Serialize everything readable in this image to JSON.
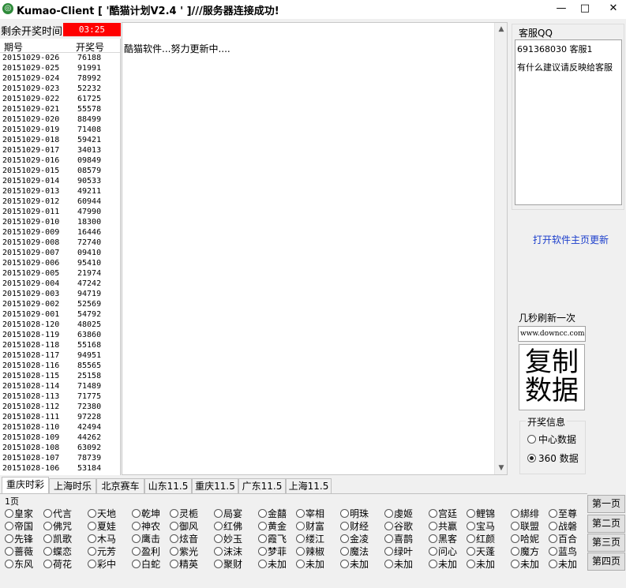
{
  "window": {
    "title": "Kumao-Client [ '酷猫计划V2.4 ' ]///服务器连接成功!",
    "min": "—",
    "max": "□",
    "close": "✕"
  },
  "countdown": {
    "label": "剩余开奖时间:",
    "value": "03:25"
  },
  "history": {
    "headers": [
      "期号",
      "开奖号"
    ],
    "rows": [
      [
        "20151029-026",
        "76188"
      ],
      [
        "20151029-025",
        "91991"
      ],
      [
        "20151029-024",
        "78992"
      ],
      [
        "20151029-023",
        "52232"
      ],
      [
        "20151029-022",
        "61725"
      ],
      [
        "20151029-021",
        "55578"
      ],
      [
        "20151029-020",
        "88499"
      ],
      [
        "20151029-019",
        "71408"
      ],
      [
        "20151029-018",
        "59421"
      ],
      [
        "20151029-017",
        "34013"
      ],
      [
        "20151029-016",
        "09849"
      ],
      [
        "20151029-015",
        "08579"
      ],
      [
        "20151029-014",
        "90533"
      ],
      [
        "20151029-013",
        "49211"
      ],
      [
        "20151029-012",
        "60944"
      ],
      [
        "20151029-011",
        "47990"
      ],
      [
        "20151029-010",
        "18300"
      ],
      [
        "20151029-009",
        "16446"
      ],
      [
        "20151029-008",
        "72740"
      ],
      [
        "20151029-007",
        "09410"
      ],
      [
        "20151029-006",
        "95410"
      ],
      [
        "20151029-005",
        "21974"
      ],
      [
        "20151029-004",
        "47242"
      ],
      [
        "20151029-003",
        "94719"
      ],
      [
        "20151029-002",
        "52569"
      ],
      [
        "20151029-001",
        "54792"
      ],
      [
        "20151028-120",
        "48025"
      ],
      [
        "20151028-119",
        "63860"
      ],
      [
        "20151028-118",
        "55168"
      ],
      [
        "20151028-117",
        "94951"
      ],
      [
        "20151028-116",
        "85565"
      ],
      [
        "20151028-115",
        "25158"
      ],
      [
        "20151028-114",
        "71489"
      ],
      [
        "20151028-113",
        "71775"
      ],
      [
        "20151028-112",
        "72380"
      ],
      [
        "20151028-111",
        "97228"
      ],
      [
        "20151028-110",
        "42494"
      ],
      [
        "20151028-109",
        "44262"
      ],
      [
        "20151028-108",
        "63092"
      ],
      [
        "20151028-107",
        "78739"
      ],
      [
        "20151028-106",
        "53184"
      ]
    ]
  },
  "center": {
    "message": "酷猫软件...努力更新中...."
  },
  "support": {
    "label": "客服QQ",
    "line1": "691368030   客服1",
    "line2": "有什么建议请反映给客服"
  },
  "links": {
    "open_home": "打开软件主页更新"
  },
  "refresh": {
    "label": "几秒刷新一次",
    "site": "www.downcc.com"
  },
  "copy_button": {
    "line1": "复制",
    "line2": "数据"
  },
  "prize_info": {
    "title": "开奖信息",
    "options": [
      "中心数据",
      "360 数据"
    ],
    "selected": "360 数据"
  },
  "tabs": [
    "重庆时彩",
    "上海时乐",
    "北京赛车",
    "山东11.5",
    "重庆11.5",
    "广东11.5",
    "上海11.5"
  ],
  "active_tab": "重庆时彩",
  "page_label": "1页",
  "plan_options": [
    [
      "皇家",
      "代言",
      "天地",
      "乾坤",
      "灵栀",
      "局宴",
      "金囍",
      "宰相",
      "明珠",
      "虔姬",
      "宫廷",
      "鲤锦",
      "綁绯",
      "至尊"
    ],
    [
      "帝国",
      "佛咒",
      "夏娃",
      "神农",
      "御风",
      "红佛",
      "黄金",
      "财富",
      "财经",
      "谷歌",
      "共赢",
      "宝马",
      "联盟",
      "战磐"
    ],
    [
      "先锋",
      "凯歌",
      "木马",
      "鹰击",
      "炫音",
      "妙玉",
      "霞飞",
      "缕江",
      "金凌",
      "喜鹊",
      "黑客",
      "红颜",
      "哈妮",
      "百合"
    ],
    [
      "蔷薇",
      "蝶恋",
      "元芳",
      "盈利",
      "紫光",
      "沫沫",
      "梦菲",
      "辣椒",
      "魔法",
      "绿叶",
      "问心",
      "天蓬",
      "魔方",
      "蓝鸟"
    ],
    [
      "东风",
      "荷花",
      "彩中",
      "白蛇",
      "精英",
      "聚财",
      "未加",
      "未加",
      "未加",
      "未加",
      "未加",
      "未加",
      "未加",
      "未加"
    ]
  ],
  "page_buttons": [
    "第一页",
    "第二页",
    "第三页",
    "第四页"
  ]
}
